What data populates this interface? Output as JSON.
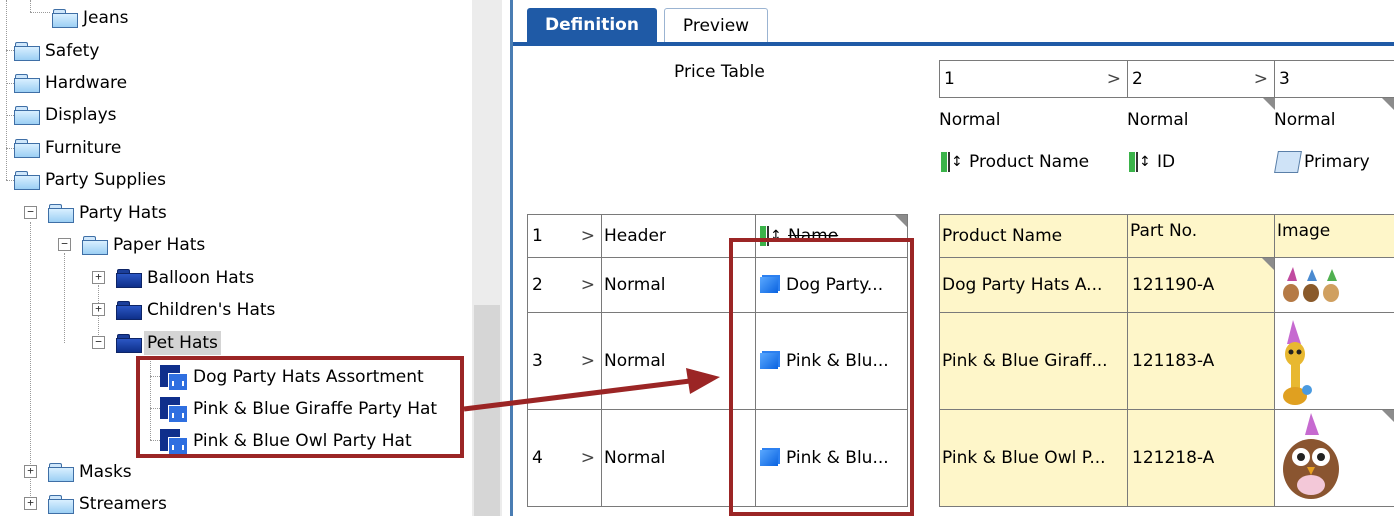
{
  "tree": {
    "items": [
      {
        "label": "Jeans"
      },
      {
        "label": "Safety"
      },
      {
        "label": "Hardware"
      },
      {
        "label": "Displays"
      },
      {
        "label": "Furniture"
      },
      {
        "label": "Party Supplies"
      },
      {
        "label": "Party Hats"
      },
      {
        "label": "Paper Hats"
      },
      {
        "label": "Balloon Hats"
      },
      {
        "label": "Children's Hats"
      },
      {
        "label": "Pet Hats"
      },
      {
        "label": "Dog Party Hats Assortment"
      },
      {
        "label": "Pink & Blue Giraffe Party Hat"
      },
      {
        "label": "Pink & Blue Owl Party Hat"
      },
      {
        "label": "Masks"
      },
      {
        "label": "Streamers"
      }
    ],
    "expanders": {
      "plus": "+",
      "minus": "−"
    }
  },
  "tabs": [
    {
      "label": "Definition"
    },
    {
      "label": "Preview"
    }
  ],
  "price_table_title": "Price Table",
  "columns": [
    {
      "num": "1",
      "type": "Normal",
      "field": "Product Name"
    },
    {
      "num": "2",
      "type": "Normal",
      "field": "ID"
    },
    {
      "num": "3",
      "type": "Normal",
      "field": "Primary"
    }
  ],
  "rows": [
    {
      "num": "1",
      "type": "Header",
      "name": "Name"
    },
    {
      "num": "2",
      "type": "Normal",
      "name": "Dog Party..."
    },
    {
      "num": "3",
      "type": "Normal",
      "name": "Pink & Blu..."
    },
    {
      "num": "4",
      "type": "Normal",
      "name": "Pink & Blu..."
    }
  ],
  "grid": {
    "header": [
      "Product Name",
      "Part No.",
      "Image"
    ],
    "rows": [
      [
        "Dog Party Hats A...",
        "121190-A"
      ],
      [
        "Pink & Blue Giraff...",
        "121183-A"
      ],
      [
        "Pink & Blue Owl P...",
        "121218-A"
      ]
    ]
  },
  "glyphs": {
    "chevron": ">",
    "sort": "↕"
  },
  "colors": {
    "tab_active": "#1f5aa6",
    "highlight_box": "#9b2525",
    "header_fill": "#fef6c9"
  }
}
